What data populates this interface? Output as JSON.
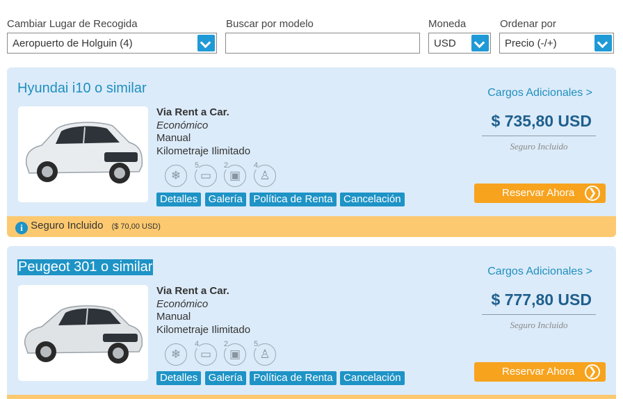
{
  "filters": {
    "pickup": {
      "label": "Cambiar Lugar de Recogida",
      "value": "Aeropuerto de Holguin (4)"
    },
    "search": {
      "label": "Buscar por modelo",
      "value": ""
    },
    "currency": {
      "label": "Moneda",
      "value": "USD"
    },
    "sort": {
      "label": "Ordenar por",
      "value": "Precio (-/+)"
    }
  },
  "cars": [
    {
      "title": "Hyundai i10 o similar",
      "agency": "Via Rent a Car.",
      "category": "Económico",
      "transmission": "Manual",
      "mileage": "Kilometraje Ilimitado",
      "features": {
        "ac": "❄",
        "doors": "5",
        "bags": "2",
        "seats": "4"
      },
      "tags": [
        "Detalles",
        "Galería",
        "Política de Renta",
        "Cancelación"
      ],
      "extra_link": "Cargos Adicionales >",
      "price": "$ 735,80 USD",
      "insurance_note": "Seguro Incluido",
      "book_label": "Reservar Ahora",
      "bar_text": "Seguro Incluido",
      "bar_amount": "($ 70,00 USD)",
      "body_color": "#e9ecef"
    },
    {
      "title": "Peugeot 301 o similar",
      "agency": "Via Rent a Car.",
      "category": "Económico",
      "transmission": "Manual",
      "mileage": "Kilometraje Ilimitado",
      "features": {
        "ac": "❄",
        "doors": "4",
        "bags": "2",
        "seats": "5"
      },
      "tags": [
        "Detalles",
        "Galería",
        "Política de Renta",
        "Cancelación"
      ],
      "extra_link": "Cargos Adicionales >",
      "price": "$ 777,80 USD",
      "insurance_note": "Seguro Incluido",
      "book_label": "Reservar Ahora",
      "bar_text": "",
      "bar_amount": "",
      "body_color": "#dfe3e6"
    }
  ],
  "colors": {
    "accent": "#1e93c6",
    "book_button": "#f7a31e",
    "card_bg": "#dcebf9",
    "insurance_bar": "#fcc970"
  }
}
